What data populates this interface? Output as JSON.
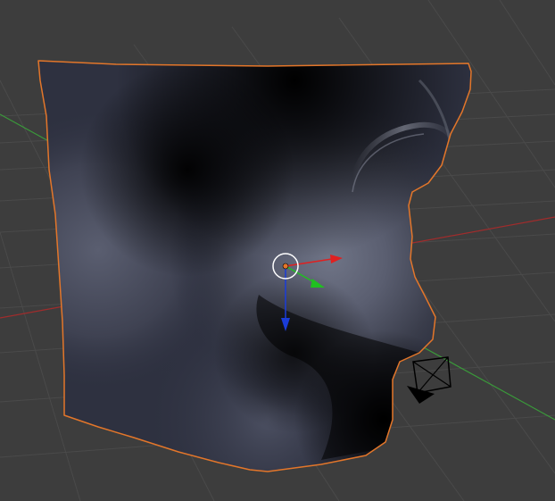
{
  "viewport": {
    "background_color": "#3d3d3d",
    "grid_color": "#4a4a4a",
    "x_axis_color": "#a02c2c",
    "y_axis_color": "#3a9a3a"
  },
  "mesh": {
    "selection_outline_color": "#e3762a",
    "shading_base_color": "#2e3140",
    "shading_highlight_color": "#6f7486"
  },
  "gizmo": {
    "x_arrow_color": "#e02020",
    "y_arrow_color": "#20c020",
    "z_arrow_color": "#1a3cd8",
    "pivot_color": "#e3762a",
    "icons": [
      "transform-manipulator-icon",
      "object-origin-icon",
      "arrow-x-icon",
      "arrow-y-icon",
      "arrow-z-icon"
    ]
  },
  "camera": {
    "color": "#000000",
    "icon": "camera-object-icon"
  }
}
